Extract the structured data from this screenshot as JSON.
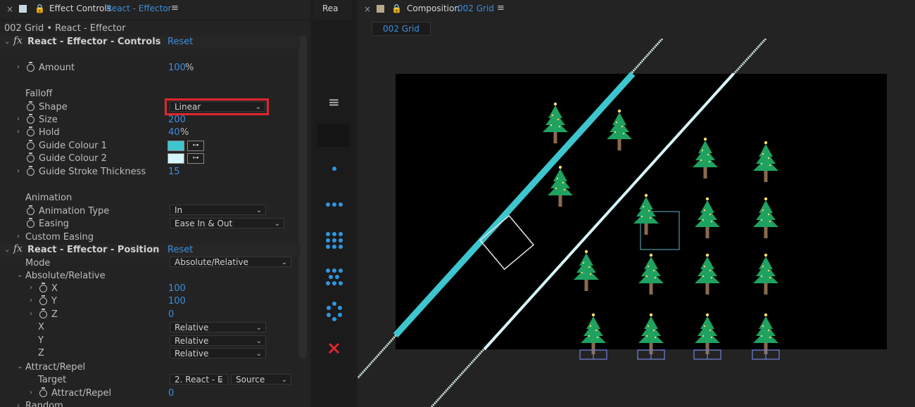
{
  "effect_controls": {
    "tab_title": "Effect Controls",
    "tab_layer": "React - Effector",
    "breadcrumb": "002 Grid • React - Effector",
    "controls_header": "React - Effector - Controls",
    "reset": "Reset",
    "amount_label": "Amount",
    "amount_value": "100",
    "amount_unit": "%",
    "falloff_label": "Falloff",
    "shape_label": "Shape",
    "shape_value": "Linear",
    "size_label": "Size",
    "size_value": "200",
    "hold_label": "Hold",
    "hold_value": "40",
    "hold_unit": "%",
    "guide1_label": "Guide Colour 1",
    "guide1_color": "#3ec6cf",
    "guide2_label": "Guide Colour 2",
    "guide2_color": "#d7f6fb",
    "stroke_label": "Guide Stroke Thickness",
    "stroke_value": "15",
    "animation_label": "Animation",
    "anim_type_label": "Animation Type",
    "anim_type_value": "In",
    "easing_label": "Easing",
    "easing_value": "Ease In & Out",
    "custom_easing_label": "Custom Easing",
    "position_header": "React - Effector - Position",
    "mode_label": "Mode",
    "mode_value": "Absolute/Relative",
    "absrel_label": "Absolute/Relative",
    "x_label": "X",
    "x_value": "100",
    "y_label": "Y",
    "y_value": "100",
    "z_label": "Z",
    "z_value": "0",
    "x_mode_label": "X",
    "x_mode_value": "Relative",
    "y_mode_label": "Y",
    "y_mode_value": "Relative",
    "z_mode_label": "Z",
    "z_mode_value": "Relative",
    "attract_group_label": "Attract/Repel",
    "target_label": "Target",
    "target_value": "2. React - E",
    "target_source": "Source",
    "attract_label": "Attract/Repel",
    "attract_value": "0",
    "random_label": "Random"
  },
  "middle": {
    "tab_label": "Rea"
  },
  "composition": {
    "tab_title": "Composition",
    "tab_comp": "002 Grid",
    "sub_tab": "002 Grid"
  },
  "colors": {
    "accent_blue": "#3d8edb",
    "highlight_red": "#e0262e",
    "tool_blue": "#2f97e0",
    "tree_green": "#1fa160"
  }
}
